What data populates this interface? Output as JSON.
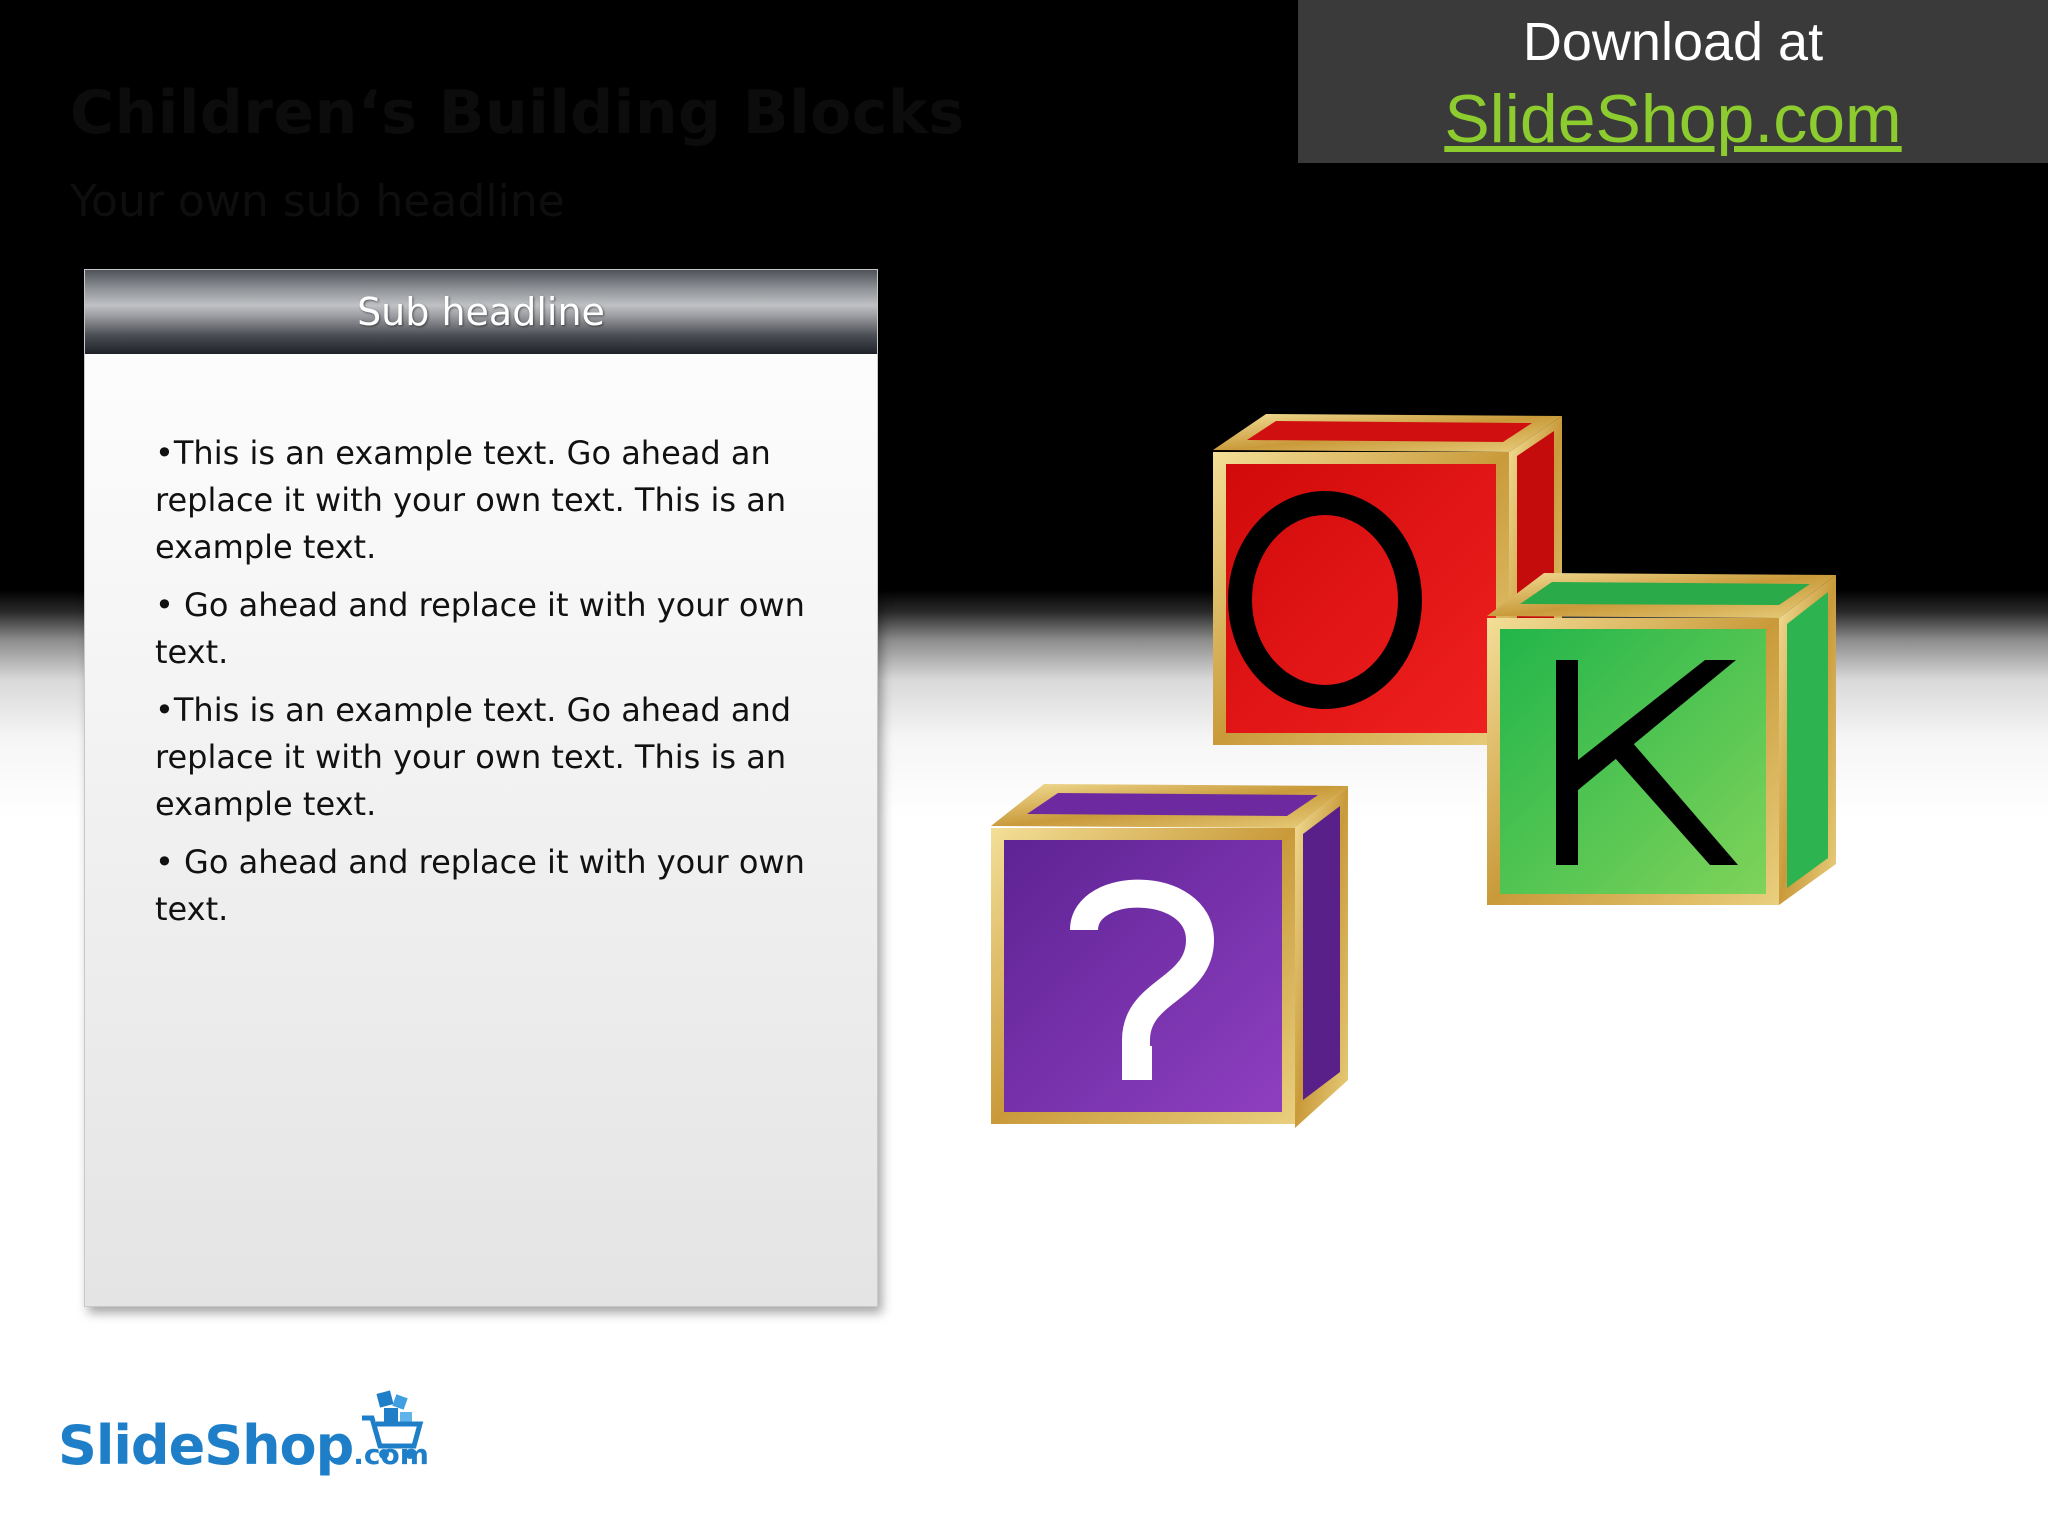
{
  "slide": {
    "title": "Children‘s Building Blocks",
    "subtitle": "Your own sub headline"
  },
  "download_banner": {
    "label": "Download at",
    "link_text": "SlideShop.com",
    "link_color": "#8ccc2e",
    "background": "#3a3a3a"
  },
  "panel": {
    "header": "Sub headline",
    "bullets": [
      "•This is an example text. Go ahead an replace it with your own text. This is an example text.",
      "• Go ahead and replace it with your own text.",
      "•This is an example text. Go ahead and replace it with your own text. This is an example text.",
      "• Go ahead and replace it with your own text."
    ]
  },
  "blocks": [
    {
      "letter": "O",
      "face_color": "#e0120f",
      "letter_color": "#000000"
    },
    {
      "letter": "K",
      "face_color": "#3cc04a",
      "letter_color": "#000000"
    },
    {
      "letter": "?",
      "face_color": "#7a2ea8",
      "letter_color": "#ffffff"
    }
  ],
  "brand": {
    "name": "SlideShop",
    "suffix": ".com",
    "color": "#1e7fc8"
  }
}
